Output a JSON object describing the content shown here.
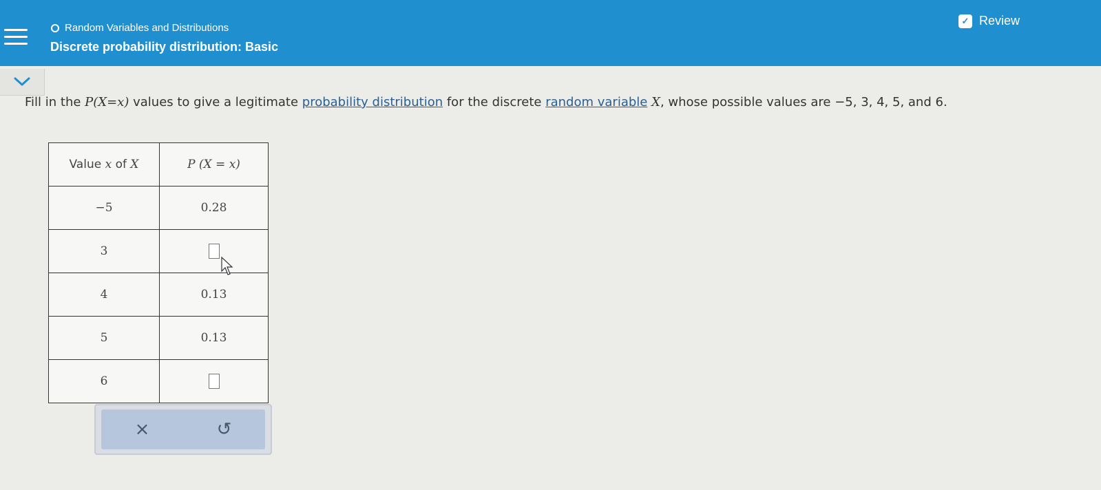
{
  "header": {
    "topic": "Random Variables and Distributions",
    "subtitle": "Discrete probability distribution: Basic",
    "review_label": "Review"
  },
  "question": {
    "part1": "Fill in the ",
    "px_lhs": "P",
    "px_arg": "(X=x)",
    "part2": " values to give a legitimate ",
    "link1": "probability distribution",
    "part3": " for the discrete ",
    "link2": "random variable",
    "var": "X",
    "part4": ", whose possible values are ",
    "values_text": "−5, 3, 4, 5,",
    "part5": " and ",
    "last_value": "6",
    "period": "."
  },
  "table": {
    "header_col1_text": "Value ",
    "header_col1_x": "x",
    "header_col1_of": " of ",
    "header_col1_X": "X",
    "header_col2": "P (X = x)",
    "rows": [
      {
        "x": "−5",
        "p": "0.28"
      },
      {
        "x": "3",
        "p": ""
      },
      {
        "x": "4",
        "p": "0.13"
      },
      {
        "x": "5",
        "p": "0.13"
      },
      {
        "x": "6",
        "p": ""
      }
    ]
  },
  "toolbar": {
    "clear_symbol": "×",
    "undo_symbol": "↺"
  },
  "colors": {
    "header_bg": "#1f8fd0",
    "link": "#2a5f8f",
    "toolbar_inner": "#b6c6dc"
  }
}
